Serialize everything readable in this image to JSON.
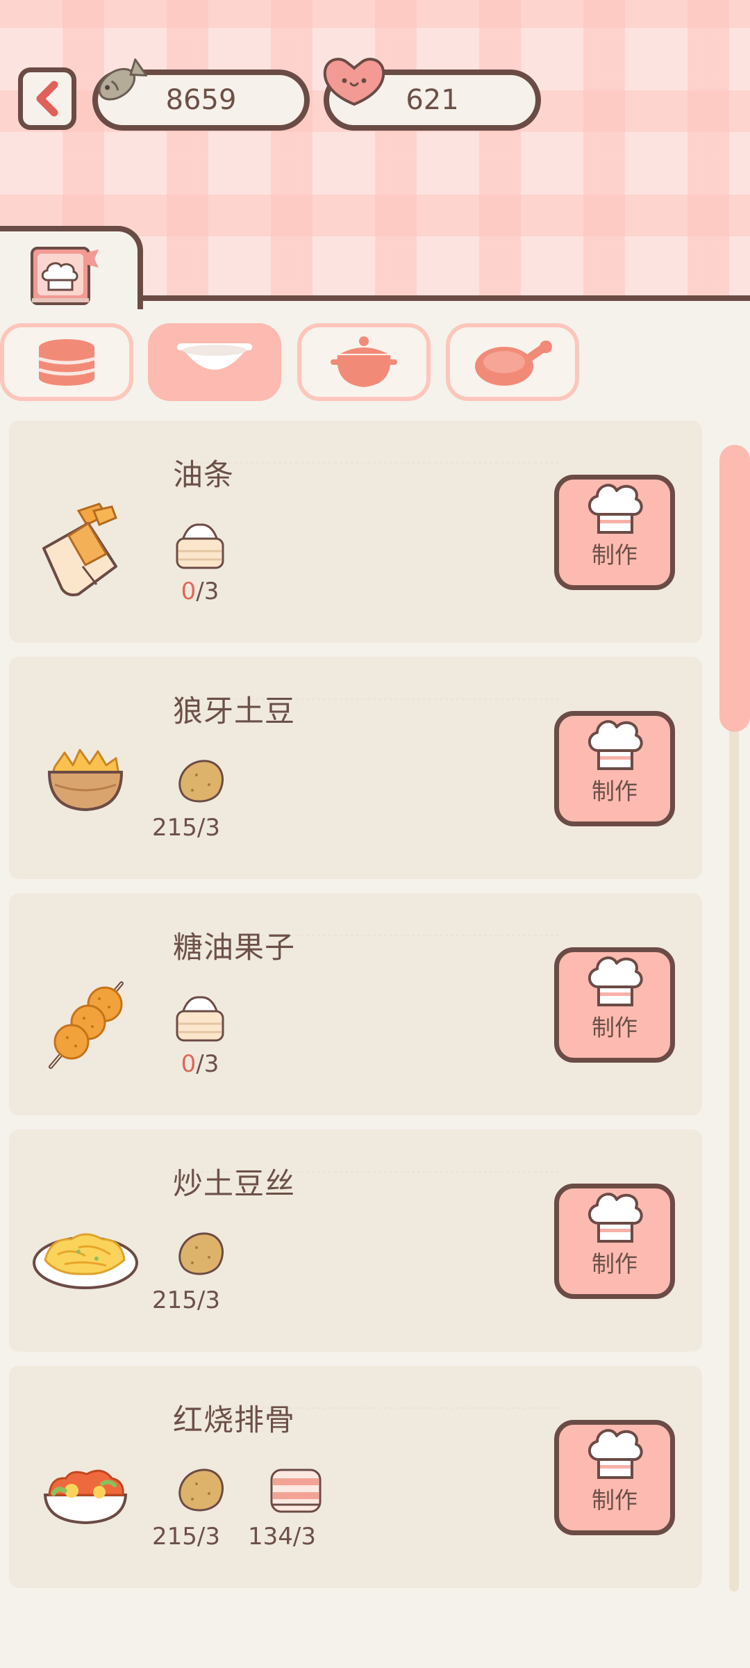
{
  "currency": {
    "fish_value": "8659",
    "heart_value": "621"
  },
  "categories": [
    {
      "icon": "steamer-icon",
      "active": false
    },
    {
      "icon": "wok-icon",
      "active": true
    },
    {
      "icon": "clay-pot-icon",
      "active": false
    },
    {
      "icon": "frying-pan-icon",
      "active": false
    }
  ],
  "recipes": [
    {
      "name": "油条",
      "dish_icon": "youtiao-icon",
      "ingredients": [
        {
          "icon": "flour-icon",
          "have": "0",
          "need": "/3",
          "short": true
        }
      ],
      "button_label": "制作"
    },
    {
      "name": "狼牙土豆",
      "dish_icon": "wolf-tooth-potato-icon",
      "ingredients": [
        {
          "icon": "potato-icon",
          "have": "215",
          "need": "/3",
          "short": false
        }
      ],
      "button_label": "制作"
    },
    {
      "name": "糖油果子",
      "dish_icon": "sugar-fried-dough-icon",
      "ingredients": [
        {
          "icon": "flour-icon",
          "have": "0",
          "need": "/3",
          "short": true
        }
      ],
      "button_label": "制作"
    },
    {
      "name": "炒土豆丝",
      "dish_icon": "shredded-potato-icon",
      "ingredients": [
        {
          "icon": "potato-icon",
          "have": "215",
          "need": "/3",
          "short": false
        }
      ],
      "button_label": "制作"
    },
    {
      "name": "红烧排骨",
      "dish_icon": "braised-ribs-icon",
      "ingredients": [
        {
          "icon": "potato-icon",
          "have": "215",
          "need": "/3",
          "short": false
        },
        {
          "icon": "pork-icon",
          "have": "134",
          "need": "/3",
          "short": false
        }
      ],
      "button_label": "制作"
    }
  ],
  "colors": {
    "accent": "#fdbab0",
    "outline": "#6b4b45",
    "shortage": "#e0685b",
    "card": "#f0e9de"
  }
}
